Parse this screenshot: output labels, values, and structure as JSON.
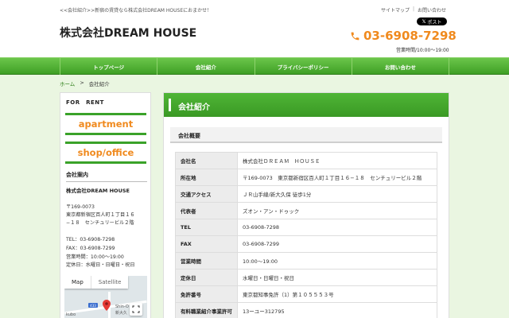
{
  "header": {
    "tagline": "<<会社紹介>>新宿の賃貸なら株式会社DREAM HOUSEにおまかせ！",
    "top_links": [
      "サイトマップ",
      "お問い合わせ"
    ],
    "x_post_label": "ポスト",
    "site_title": "株式会社DREAM HOUSE",
    "phone": "03-6908-7298",
    "hours": "営業時間/10:00〜19:00",
    "accent_color": "#f08a1e"
  },
  "nav": {
    "items": [
      "トップページ",
      "会社紹介",
      "プライバシーポリシー",
      "お問い合わせ"
    ],
    "color": "#4fb536"
  },
  "breadcrumb": {
    "home": "ホーム",
    "sep": ">",
    "current": "会社紹介"
  },
  "sidebar": {
    "for_rent": "FOR　RENT",
    "apartment_label": "apartment",
    "shop_label": "shop/office",
    "heading": "会社案内",
    "company": "株式会社DREAM HOUSE",
    "address_lines": [
      "〒169-0073",
      "東京都新宿区百人町１丁目１６",
      "−１８　センチュリービル２階"
    ],
    "contact_lines": [
      "TEL：03-6908-7298",
      "FAX：03-6908-7299",
      "営業時間：10:00〜19:00",
      "定休日：水曜日・日曜日・祝日"
    ],
    "map": {
      "tab_map": "Map",
      "tab_satellite": "Satellite",
      "label_station": "Shin-O",
      "label_station2": "新大久",
      "label_okubo": "kubo",
      "label_badge": "433"
    }
  },
  "main": {
    "title": "会社紹介",
    "section_heading": "会社概要",
    "rows": [
      {
        "key": "会社名",
        "value": "株式会社ＤＲＥＡＭ　ＨＯＵＳＥ"
      },
      {
        "key": "所在地",
        "value": "〒169-0073　東京都新宿区百人町１丁目１６−１８　センチュリービル２階"
      },
      {
        "key": "交通アクセス",
        "value": "ＪＲ山手線/新大久保 徒歩1分"
      },
      {
        "key": "代表者",
        "value": "ズオン・アン・ドゥック"
      },
      {
        "key": "TEL",
        "value": "03-6908-7298"
      },
      {
        "key": "FAX",
        "value": "03-6908-7299"
      },
      {
        "key": "営業時間",
        "value": "10:00〜19:00"
      },
      {
        "key": "定休日",
        "value": "水曜日・日曜日・祝日"
      },
      {
        "key": "免許番号",
        "value": "東京都知事免許（1）第１０５５５３号"
      },
      {
        "key": "有料職業紹介事業許可",
        "value": "13ーユー312795"
      }
    ]
  }
}
